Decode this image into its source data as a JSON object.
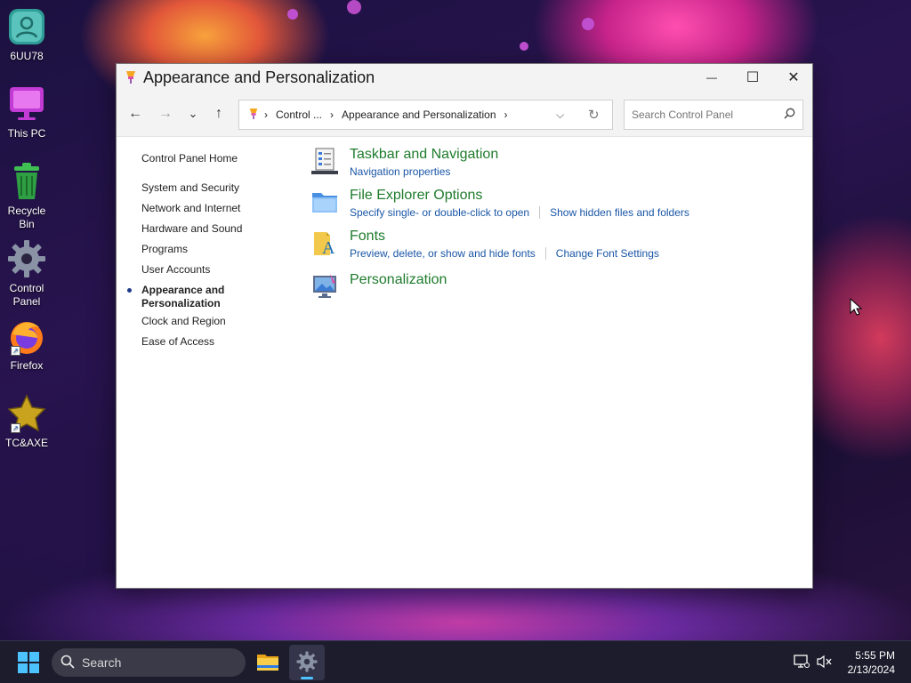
{
  "desktop": {
    "icons": [
      {
        "label": "6UU78"
      },
      {
        "label": "This PC"
      },
      {
        "label": "Recycle Bin"
      },
      {
        "label": "Control Panel"
      },
      {
        "label": "Firefox"
      },
      {
        "label": "TC&AXE"
      }
    ]
  },
  "window": {
    "title": "Appearance and Personalization",
    "controls": {
      "minimize": "—",
      "maximize": "☐",
      "close": "✕"
    }
  },
  "nav": {
    "back": "←",
    "forward": "→",
    "recent": "⌄",
    "up": "↑",
    "breadcrumb": [
      "Control ...",
      "Appearance and Personalization"
    ],
    "search_placeholder": "Search Control Panel"
  },
  "sidebar": {
    "home": "Control Panel Home",
    "items": [
      {
        "label": "System and Security"
      },
      {
        "label": "Network and Internet"
      },
      {
        "label": "Hardware and Sound"
      },
      {
        "label": "Programs"
      },
      {
        "label": "User Accounts"
      },
      {
        "label_line1": "Appearance and",
        "label_line2": "Personalization",
        "active": true
      },
      {
        "label": "Clock and Region"
      },
      {
        "label": "Ease of Access"
      }
    ]
  },
  "categories": [
    {
      "title": "Taskbar and Navigation",
      "links": [
        "Navigation properties"
      ],
      "icon": "taskbar-icon"
    },
    {
      "title": "File Explorer Options",
      "links": [
        "Specify single- or double-click to open",
        "Show hidden files and folders"
      ],
      "icon": "folder-options-icon"
    },
    {
      "title": "Fonts",
      "links": [
        "Preview, delete, or show and hide fonts",
        "Change Font Settings"
      ],
      "icon": "fonts-icon"
    },
    {
      "title": "Personalization",
      "links": [],
      "icon": "personalization-icon"
    }
  ],
  "taskbar": {
    "search_label": "Search",
    "time": "5:55 PM",
    "date": "2/13/2024"
  },
  "colors": {
    "link_blue": "#1a56a6",
    "category_green": "#1e7b2c",
    "taskbar_bg": "#1c1c2c"
  }
}
